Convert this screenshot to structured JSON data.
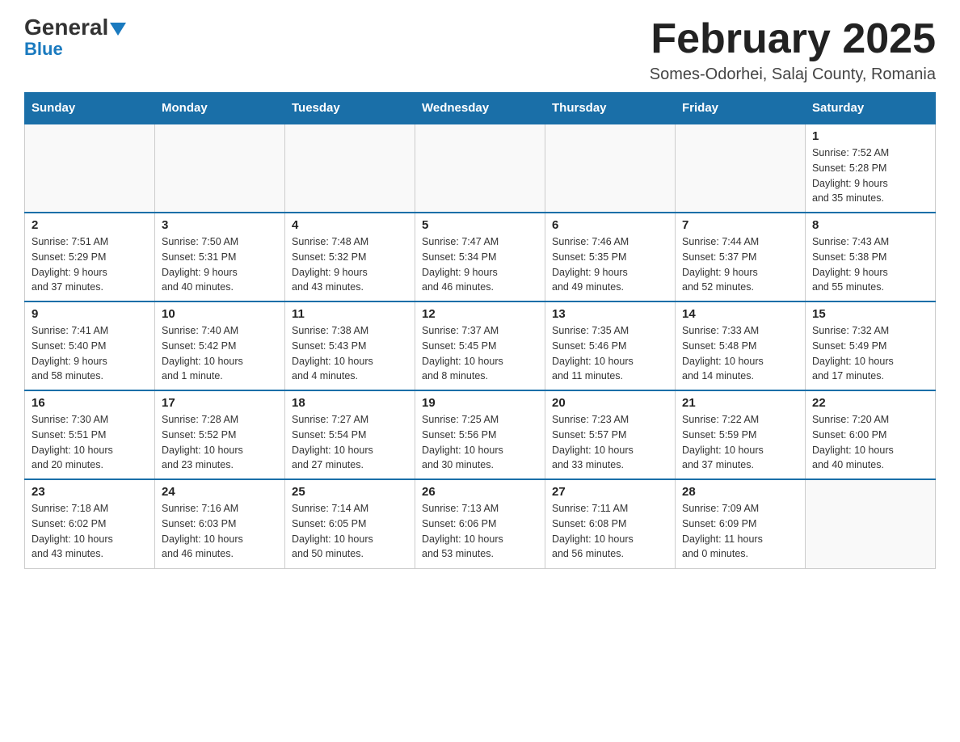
{
  "logo": {
    "general": "General",
    "blue": "Blue"
  },
  "header": {
    "title": "February 2025",
    "location": "Somes-Odorhei, Salaj County, Romania"
  },
  "days_of_week": [
    "Sunday",
    "Monday",
    "Tuesday",
    "Wednesday",
    "Thursday",
    "Friday",
    "Saturday"
  ],
  "weeks": [
    {
      "days": [
        {
          "date": "",
          "info": ""
        },
        {
          "date": "",
          "info": ""
        },
        {
          "date": "",
          "info": ""
        },
        {
          "date": "",
          "info": ""
        },
        {
          "date": "",
          "info": ""
        },
        {
          "date": "",
          "info": ""
        },
        {
          "date": "1",
          "info": "Sunrise: 7:52 AM\nSunset: 5:28 PM\nDaylight: 9 hours\nand 35 minutes."
        }
      ]
    },
    {
      "days": [
        {
          "date": "2",
          "info": "Sunrise: 7:51 AM\nSunset: 5:29 PM\nDaylight: 9 hours\nand 37 minutes."
        },
        {
          "date": "3",
          "info": "Sunrise: 7:50 AM\nSunset: 5:31 PM\nDaylight: 9 hours\nand 40 minutes."
        },
        {
          "date": "4",
          "info": "Sunrise: 7:48 AM\nSunset: 5:32 PM\nDaylight: 9 hours\nand 43 minutes."
        },
        {
          "date": "5",
          "info": "Sunrise: 7:47 AM\nSunset: 5:34 PM\nDaylight: 9 hours\nand 46 minutes."
        },
        {
          "date": "6",
          "info": "Sunrise: 7:46 AM\nSunset: 5:35 PM\nDaylight: 9 hours\nand 49 minutes."
        },
        {
          "date": "7",
          "info": "Sunrise: 7:44 AM\nSunset: 5:37 PM\nDaylight: 9 hours\nand 52 minutes."
        },
        {
          "date": "8",
          "info": "Sunrise: 7:43 AM\nSunset: 5:38 PM\nDaylight: 9 hours\nand 55 minutes."
        }
      ]
    },
    {
      "days": [
        {
          "date": "9",
          "info": "Sunrise: 7:41 AM\nSunset: 5:40 PM\nDaylight: 9 hours\nand 58 minutes."
        },
        {
          "date": "10",
          "info": "Sunrise: 7:40 AM\nSunset: 5:42 PM\nDaylight: 10 hours\nand 1 minute."
        },
        {
          "date": "11",
          "info": "Sunrise: 7:38 AM\nSunset: 5:43 PM\nDaylight: 10 hours\nand 4 minutes."
        },
        {
          "date": "12",
          "info": "Sunrise: 7:37 AM\nSunset: 5:45 PM\nDaylight: 10 hours\nand 8 minutes."
        },
        {
          "date": "13",
          "info": "Sunrise: 7:35 AM\nSunset: 5:46 PM\nDaylight: 10 hours\nand 11 minutes."
        },
        {
          "date": "14",
          "info": "Sunrise: 7:33 AM\nSunset: 5:48 PM\nDaylight: 10 hours\nand 14 minutes."
        },
        {
          "date": "15",
          "info": "Sunrise: 7:32 AM\nSunset: 5:49 PM\nDaylight: 10 hours\nand 17 minutes."
        }
      ]
    },
    {
      "days": [
        {
          "date": "16",
          "info": "Sunrise: 7:30 AM\nSunset: 5:51 PM\nDaylight: 10 hours\nand 20 minutes."
        },
        {
          "date": "17",
          "info": "Sunrise: 7:28 AM\nSunset: 5:52 PM\nDaylight: 10 hours\nand 23 minutes."
        },
        {
          "date": "18",
          "info": "Sunrise: 7:27 AM\nSunset: 5:54 PM\nDaylight: 10 hours\nand 27 minutes."
        },
        {
          "date": "19",
          "info": "Sunrise: 7:25 AM\nSunset: 5:56 PM\nDaylight: 10 hours\nand 30 minutes."
        },
        {
          "date": "20",
          "info": "Sunrise: 7:23 AM\nSunset: 5:57 PM\nDaylight: 10 hours\nand 33 minutes."
        },
        {
          "date": "21",
          "info": "Sunrise: 7:22 AM\nSunset: 5:59 PM\nDaylight: 10 hours\nand 37 minutes."
        },
        {
          "date": "22",
          "info": "Sunrise: 7:20 AM\nSunset: 6:00 PM\nDaylight: 10 hours\nand 40 minutes."
        }
      ]
    },
    {
      "days": [
        {
          "date": "23",
          "info": "Sunrise: 7:18 AM\nSunset: 6:02 PM\nDaylight: 10 hours\nand 43 minutes."
        },
        {
          "date": "24",
          "info": "Sunrise: 7:16 AM\nSunset: 6:03 PM\nDaylight: 10 hours\nand 46 minutes."
        },
        {
          "date": "25",
          "info": "Sunrise: 7:14 AM\nSunset: 6:05 PM\nDaylight: 10 hours\nand 50 minutes."
        },
        {
          "date": "26",
          "info": "Sunrise: 7:13 AM\nSunset: 6:06 PM\nDaylight: 10 hours\nand 53 minutes."
        },
        {
          "date": "27",
          "info": "Sunrise: 7:11 AM\nSunset: 6:08 PM\nDaylight: 10 hours\nand 56 minutes."
        },
        {
          "date": "28",
          "info": "Sunrise: 7:09 AM\nSunset: 6:09 PM\nDaylight: 11 hours\nand 0 minutes."
        },
        {
          "date": "",
          "info": ""
        }
      ]
    }
  ]
}
